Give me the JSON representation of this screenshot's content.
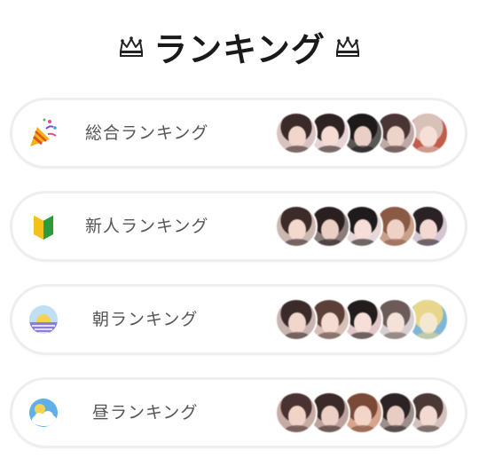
{
  "header": {
    "title": "ランキング",
    "left_icon": "crown-icon",
    "right_icon": "crown-icon"
  },
  "rankings": [
    {
      "label": "総合ランキング",
      "icon": "party-popper-icon",
      "avatars": [
        {
          "bg": "#d9c3c0",
          "hair": "#3a2a2a",
          "face": "#f2d6cc"
        },
        {
          "bg": "#e8d3d6",
          "hair": "#2e2222",
          "face": "#f4dcd3"
        },
        {
          "bg": "#5a5656",
          "hair": "#1e1a1a",
          "face": "#e9cfc6"
        },
        {
          "bg": "#bfa9a6",
          "hair": "#4a3535",
          "face": "#eed3c8"
        },
        {
          "bg": "#c25c4c",
          "hair": "#d8c1b8",
          "face": "#f5dfd6"
        }
      ]
    },
    {
      "label": "新人ランキング",
      "icon": "beginner-mark-icon",
      "avatars": [
        {
          "bg": "#cbb6b0",
          "hair": "#3b2b29",
          "face": "#f3d8ce"
        },
        {
          "bg": "#8a7c78",
          "hair": "#2a2020",
          "face": "#eccfc4"
        },
        {
          "bg": "#e6d8d8",
          "hair": "#1f1a1b",
          "face": "#f5dfd8"
        },
        {
          "bg": "#c9a08c",
          "hair": "#8a5a45",
          "face": "#efd2c6"
        },
        {
          "bg": "#d4c6d2",
          "hair": "#2b2226",
          "face": "#f3d9d2"
        }
      ]
    },
    {
      "label": "朝ランキング",
      "icon": "sunrise-icon",
      "avatars": [
        {
          "bg": "#c8b4b0",
          "hair": "#3a2b2a",
          "face": "#f2d6cc"
        },
        {
          "bg": "#d8c0b6",
          "hair": "#5a4038",
          "face": "#f4dcd2"
        },
        {
          "bg": "#e3c7c8",
          "hair": "#231c1d",
          "face": "#f6dfd8"
        },
        {
          "bg": "#d6cfd2",
          "hair": "#6d5b58",
          "face": "#f3e1da"
        },
        {
          "bg": "#7fb6d6",
          "hair": "#e8d78a",
          "face": "#f5e8d0"
        }
      ]
    },
    {
      "label": "昼ランキング",
      "icon": "sun-behind-cloud-icon",
      "avatars": [
        {
          "bg": "#c9aba6",
          "hair": "#4a3230",
          "face": "#f1d3c8"
        },
        {
          "bg": "#bda29c",
          "hair": "#3a2a28",
          "face": "#ecd0c5"
        },
        {
          "bg": "#d7a58c",
          "hair": "#7a4a38",
          "face": "#f3d6c8"
        },
        {
          "bg": "#9c8e8a",
          "hair": "#2c2424",
          "face": "#e8cdc3"
        },
        {
          "bg": "#d3c2bc",
          "hair": "#4a3835",
          "face": "#f2dad0"
        }
      ]
    }
  ]
}
